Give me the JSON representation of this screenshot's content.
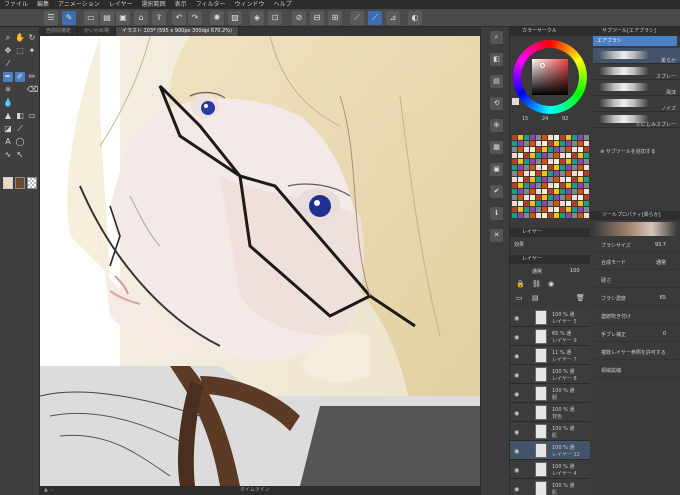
{
  "menu": [
    "ファイル",
    "編集",
    "アニメーション",
    "レイヤー",
    "選択範囲",
    "表示",
    "フィルター",
    "ウィンドウ",
    "ヘルプ"
  ],
  "tabs": [
    {
      "label": "自前前場定"
    },
    {
      "label": "かいかめ場"
    },
    {
      "label": "イラスト 103* (595 x 900px 300dpi 670.2%)"
    }
  ],
  "timeline_label": "タイムライン",
  "panels": {
    "color_circle": "カラーサークル",
    "subtool": "サブツール[エアブラシ]",
    "subtool_group": "エアブラシ",
    "tool_property": "ツールプロパティ[柔らか]",
    "layer_property": "レイヤー",
    "layer": "レイヤー"
  },
  "color_values": {
    "h": "15",
    "s": "24",
    "v": "92"
  },
  "subtools": [
    {
      "name": "柔らか"
    },
    {
      "name": "スプレー"
    },
    {
      "name": "飛沫"
    },
    {
      "name": "ノイズ"
    },
    {
      "name": "たにじみスプレー"
    }
  ],
  "add_subtool": "サブツールを追加する",
  "brush_props": {
    "size_label": "ブラシサイズ",
    "size_value": "93.7",
    "blend_label": "合成モード",
    "blend_value": "通常",
    "hardness_label": "硬さ",
    "density_label": "ブラシ濃度",
    "density_value": "65",
    "continuous_label": "連続吹き付け",
    "stabilize_label": "手ブレ補正",
    "stabilize_value": "0",
    "refer_label": "複数レイヤー参照を許可する",
    "reset_label": "領域拡縮"
  },
  "layer_panel": {
    "effect_label": "効果",
    "blend_mode": "通常",
    "opacity": "100"
  },
  "layers": [
    {
      "pct": "100 % 通",
      "name": "レイヤー 5",
      "selected": false
    },
    {
      "pct": "65 % 通",
      "name": "レイヤー 9",
      "selected": false
    },
    {
      "pct": "11 % 通",
      "name": "レイヤー 7",
      "selected": false
    },
    {
      "pct": "100 % 通",
      "name": "レイヤー 8",
      "selected": false
    },
    {
      "pct": "100 % 通",
      "name": "服",
      "selected": false
    },
    {
      "pct": "100 % 通",
      "name": "背色",
      "selected": false
    },
    {
      "pct": "100 % 通",
      "name": "肌",
      "selected": false
    },
    {
      "pct": "100 % 通",
      "name": "レイヤー 12",
      "selected": true
    },
    {
      "pct": "100 % 通",
      "name": "レイヤー 4",
      "selected": false
    },
    {
      "pct": "100 % 通",
      "name": "肌",
      "selected": false
    }
  ],
  "accent": "#4d7fc4",
  "current_color": "#f0d6c8",
  "sub_color": "#6b4a2c"
}
